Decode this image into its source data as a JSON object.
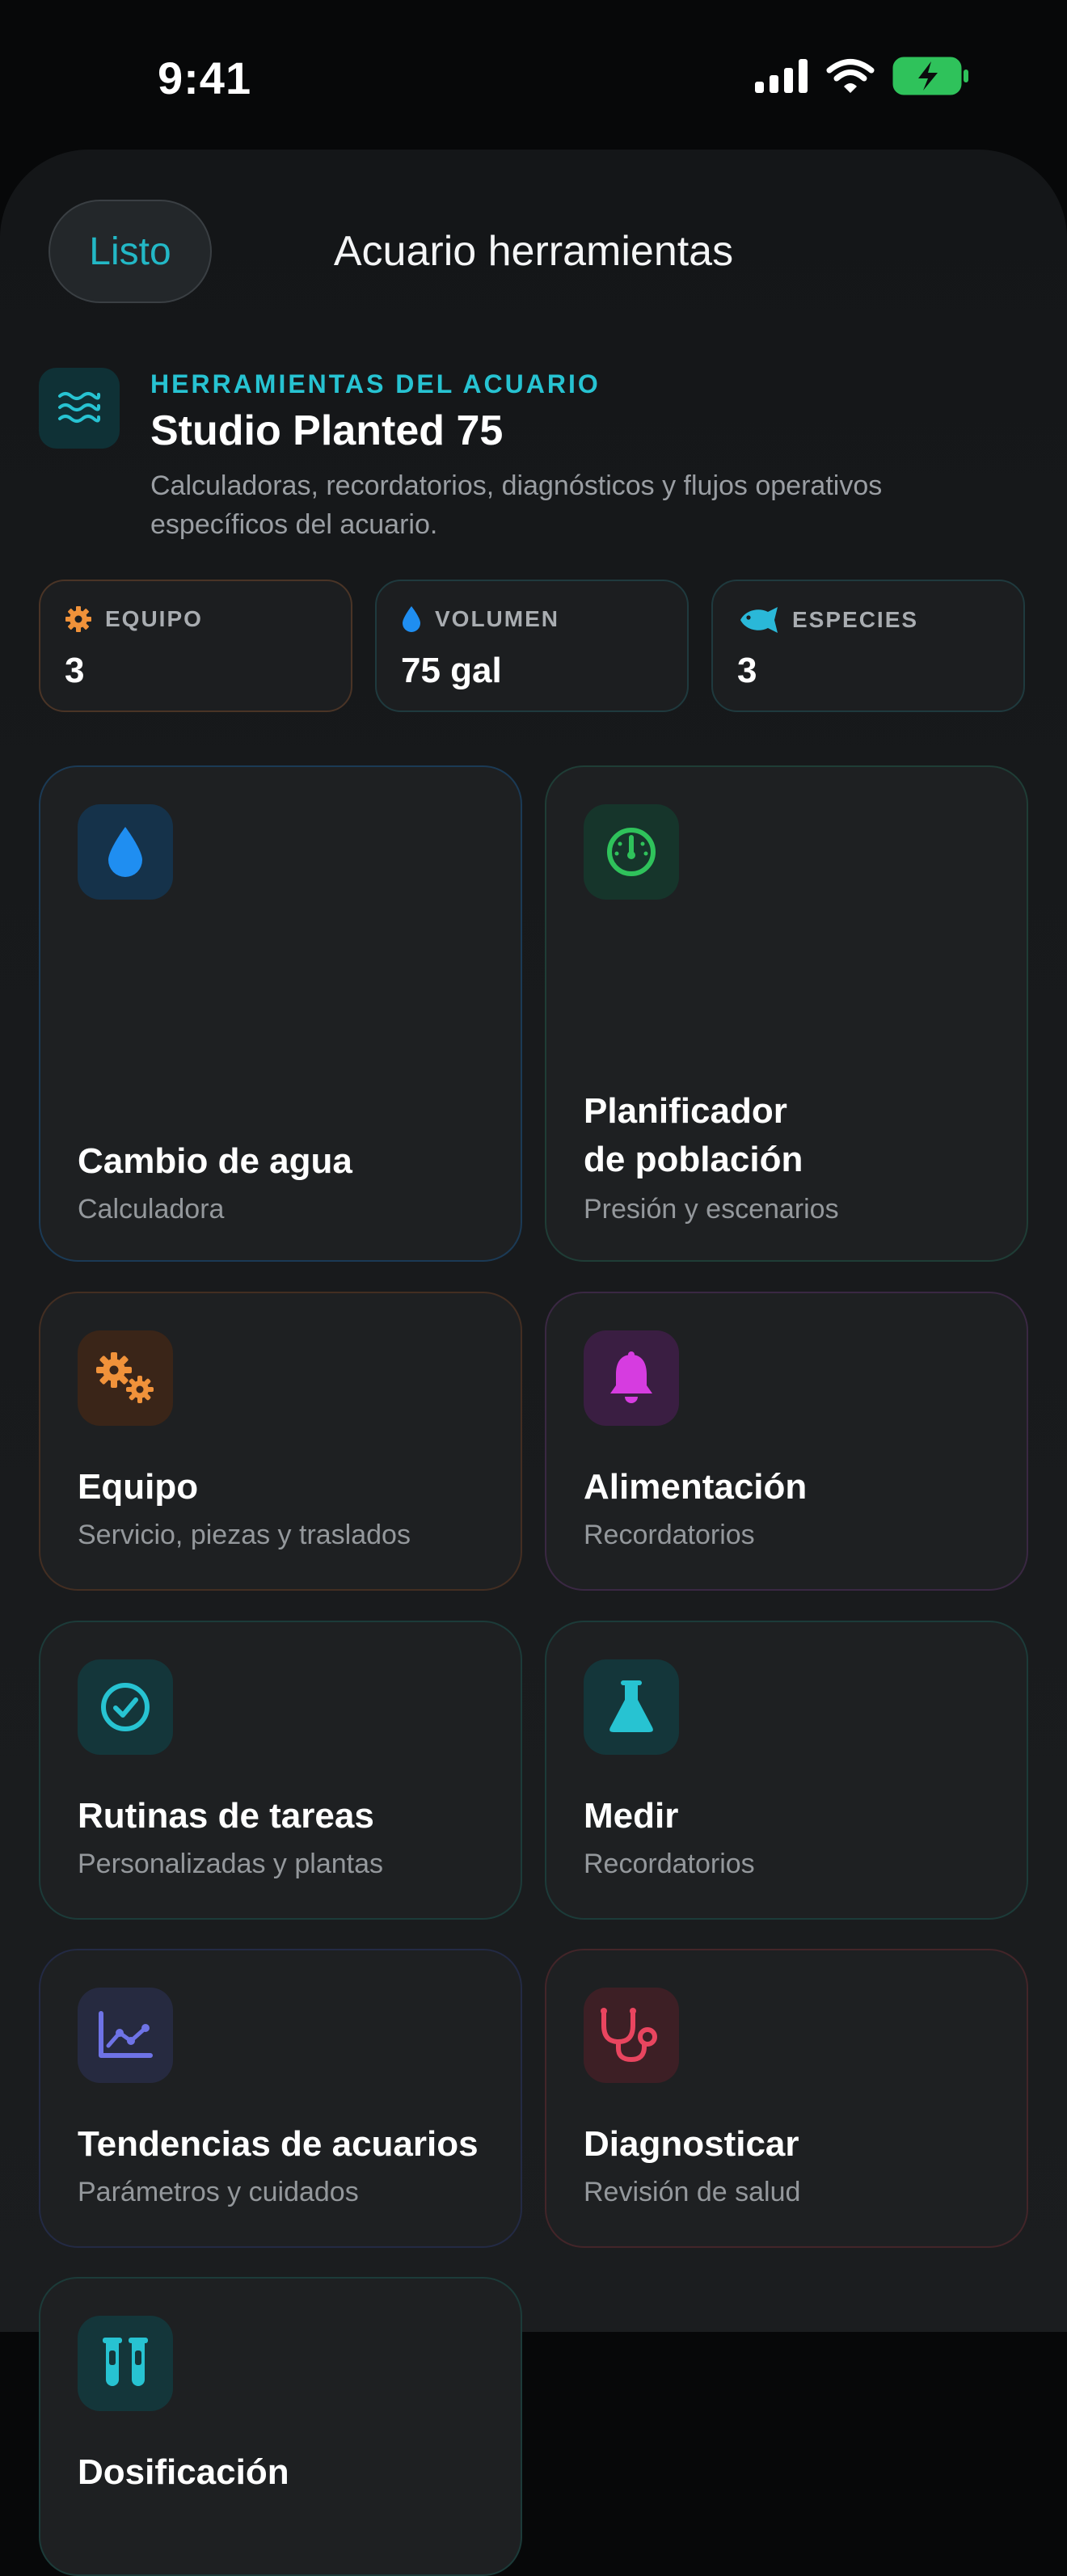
{
  "status_bar": {
    "time": "9:41"
  },
  "nav": {
    "done_label": "Listo",
    "title": "Acuario herramientas"
  },
  "hero": {
    "eyebrow": "HERRAMIENTAS DEL ACUARIO",
    "title": "Studio Planted 75",
    "description": "Calculadoras, recordatorios, diagnósticos y flujos operativos específicos del acuario.",
    "icon": "waves-icon"
  },
  "stats": [
    {
      "label": "EQUIPO",
      "value": "3",
      "icon": "gear-icon",
      "color": "#f0923a"
    },
    {
      "label": "VOLUMEN",
      "value": "75 gal",
      "icon": "drop-icon",
      "color": "#1f8ef1"
    },
    {
      "label": "ESPECIES",
      "value": "3",
      "icon": "fish-icon",
      "color": "#2ab8d8"
    }
  ],
  "tools": [
    {
      "title": "Cambio de agua",
      "subtitle": "Calculadora",
      "icon": "water-drop-icon",
      "accent": "#1f8ef1"
    },
    {
      "title": "Planificador de población",
      "subtitle": "Presión y escenarios",
      "icon": "gauge-icon",
      "accent": "#2fc25b"
    },
    {
      "title": "Equipo",
      "subtitle": "Servicio, piezas y traslados",
      "icon": "gears-icon",
      "accent": "#f0923a"
    },
    {
      "title": "Alimentación",
      "subtitle": "Recordatorios",
      "icon": "bell-icon",
      "accent": "#d63ce0"
    },
    {
      "title": "Rutinas de tareas",
      "subtitle": "Personalizadas y plantas",
      "icon": "checkmark-circle-icon",
      "accent": "#27c3d2"
    },
    {
      "title": "Medir",
      "subtitle": "Recordatorios",
      "icon": "flask-icon",
      "accent": "#27c3d2"
    },
    {
      "title": "Tendencias de acuarios",
      "subtitle": "Parámetros y cuidados",
      "icon": "trend-chart-icon",
      "accent": "#6e73e6"
    },
    {
      "title": "Diagnosticar",
      "subtitle": "Revisión de salud",
      "icon": "stethoscope-icon",
      "accent": "#e9455f"
    },
    {
      "title": "Dosificación",
      "icon": "test-tubes-icon",
      "accent": "#27c3d2"
    }
  ]
}
